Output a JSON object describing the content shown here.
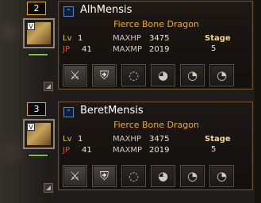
{
  "characters": [
    {
      "slot_number": "2",
      "name": "AlhMensis",
      "subtitle": "Fierce Bone Dragon",
      "lv_label": "Lv",
      "lv": "1",
      "jp_label": "JP",
      "jp": "41",
      "maxhp_label": "MAXHP",
      "maxhp": "3475",
      "maxmp_label": "MAXMP",
      "maxmp": "2019",
      "stage_label": "Stage",
      "stage": "5",
      "hp_fill": 1.0,
      "equipment": [
        {
          "icon": "sword-icon",
          "glyph": "⚔",
          "equipped": true
        },
        {
          "icon": "armor-icon",
          "glyph": "⛨",
          "equipped": true
        },
        {
          "icon": "necklace-icon",
          "glyph": "◌",
          "equipped": false
        },
        {
          "icon": "ring-icon",
          "glyph": "◕",
          "equipped": false
        },
        {
          "icon": "drop-icon",
          "glyph": "◔",
          "equipped": false
        },
        {
          "icon": "drop-icon",
          "glyph": "◔",
          "equipped": false
        }
      ]
    },
    {
      "slot_number": "3",
      "name": "BeretMensis",
      "subtitle": "Fierce Bone Dragon",
      "lv_label": "Lv",
      "lv": "1",
      "jp_label": "JP",
      "jp": "41",
      "maxhp_label": "MAXHP",
      "maxhp": "3475",
      "maxmp_label": "MAXMP",
      "maxmp": "2019",
      "stage_label": "Stage",
      "stage": "5",
      "hp_fill": 1.0,
      "equipment": [
        {
          "icon": "sword-icon",
          "glyph": "⚔",
          "equipped": true
        },
        {
          "icon": "armor-icon",
          "glyph": "⛨",
          "equipped": true
        },
        {
          "icon": "necklace-icon",
          "glyph": "◌",
          "equipped": false
        },
        {
          "icon": "ring-icon",
          "glyph": "◕",
          "equipped": false
        },
        {
          "icon": "drop-icon",
          "glyph": "◔",
          "equipped": false
        },
        {
          "icon": "drop-icon",
          "glyph": "◔",
          "equipped": false
        }
      ]
    }
  ]
}
